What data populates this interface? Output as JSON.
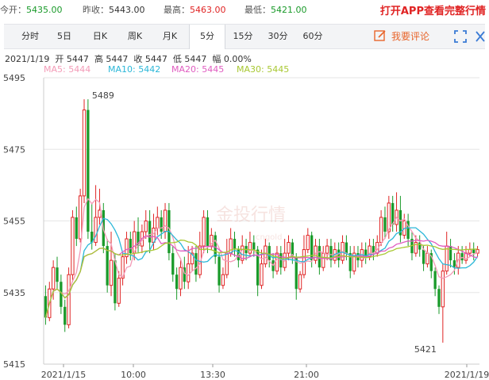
{
  "quote": {
    "open_label": "今开：",
    "open_value": "5435.00",
    "prev_label": "昨收：",
    "prev_value": "5443.00",
    "high_label": "最高：",
    "high_value": "5463.00",
    "low_label": "最低：",
    "low_value": "5421.00"
  },
  "app_link": "打开APP查看完整行情",
  "tabs": [
    {
      "label": "分时"
    },
    {
      "label": "5日"
    },
    {
      "label": "日K"
    },
    {
      "label": "周K"
    },
    {
      "label": "月K"
    },
    {
      "label": "5分"
    },
    {
      "label": "15分"
    },
    {
      "label": "30分"
    },
    {
      "label": "60分"
    }
  ],
  "active_tab": "5分",
  "comment_label": "我要评论",
  "info": {
    "date": "2021/1/19",
    "open_label": "开",
    "open": "5447",
    "high_label": "高",
    "high": "5447",
    "close_label": "收",
    "close": "5447",
    "low_label": "低",
    "low": "5447",
    "change_label": "幅",
    "change": "0.00%"
  },
  "ma": [
    {
      "label": "MA5: 5444",
      "color": "#f39bb7"
    },
    {
      "label": "MA10: 5442",
      "color": "#2bb7d8"
    },
    {
      "label": "MA20: 5445",
      "color": "#e05cc0"
    },
    {
      "label": "MA30: 5445",
      "color": "#a8c832"
    }
  ],
  "colors": {
    "up": "#e02424",
    "down": "#1a9a2a",
    "grid": "#e6e6e6"
  },
  "watermark": {
    "text": "金投行情",
    "sub": "cngold"
  },
  "chart_data": {
    "type": "candlestick",
    "ylim": [
      5415,
      5495
    ],
    "yticks": [
      5495,
      5475,
      5455,
      5435,
      5415
    ],
    "x_labels": [
      "2021/1/15",
      "10:00",
      "13:30",
      "21:00",
      "2021/1/19"
    ],
    "annotations": [
      {
        "text": "5489",
        "value": 5489
      },
      {
        "text": "5421",
        "value": 5421
      }
    ],
    "candles": [
      [
        5434,
        5428,
        5437,
        5426
      ],
      [
        5428,
        5436,
        5438,
        5427
      ],
      [
        5436,
        5442,
        5444,
        5433
      ],
      [
        5442,
        5438,
        5445,
        5436
      ],
      [
        5438,
        5431,
        5440,
        5429
      ],
      [
        5431,
        5426,
        5433,
        5424
      ],
      [
        5426,
        5440,
        5442,
        5425
      ],
      [
        5440,
        5456,
        5458,
        5438
      ],
      [
        5456,
        5450,
        5459,
        5448
      ],
      [
        5450,
        5462,
        5464,
        5449
      ],
      [
        5462,
        5486,
        5489,
        5460
      ],
      [
        5486,
        5452,
        5489,
        5450
      ],
      [
        5452,
        5449,
        5460,
        5447
      ],
      [
        5449,
        5456,
        5465,
        5448
      ],
      [
        5456,
        5458,
        5464,
        5454
      ],
      [
        5458,
        5448,
        5460,
        5446
      ],
      [
        5448,
        5437,
        5450,
        5435
      ],
      [
        5437,
        5444,
        5452,
        5434
      ],
      [
        5444,
        5432,
        5446,
        5430
      ],
      [
        5432,
        5439,
        5441,
        5431
      ],
      [
        5439,
        5445,
        5446,
        5437
      ],
      [
        5445,
        5450,
        5452,
        5443
      ],
      [
        5450,
        5446,
        5452,
        5444
      ],
      [
        5446,
        5452,
        5455,
        5444
      ],
      [
        5452,
        5448,
        5456,
        5446
      ],
      [
        5448,
        5452,
        5454,
        5446
      ],
      [
        5452,
        5455,
        5458,
        5450
      ],
      [
        5455,
        5449,
        5458,
        5446
      ],
      [
        5449,
        5453,
        5457,
        5447
      ],
      [
        5453,
        5456,
        5459,
        5451
      ],
      [
        5456,
        5452,
        5458,
        5450
      ],
      [
        5452,
        5458,
        5460,
        5450
      ],
      [
        5458,
        5446,
        5460,
        5444
      ],
      [
        5446,
        5440,
        5448,
        5438
      ],
      [
        5440,
        5436,
        5442,
        5433
      ],
      [
        5436,
        5442,
        5444,
        5434
      ],
      [
        5442,
        5438,
        5445,
        5436
      ],
      [
        5438,
        5443,
        5448,
        5436
      ],
      [
        5443,
        5446,
        5448,
        5441
      ],
      [
        5446,
        5440,
        5448,
        5438
      ],
      [
        5440,
        5448,
        5452,
        5439
      ],
      [
        5448,
        5456,
        5458,
        5446
      ],
      [
        5456,
        5448,
        5458,
        5446
      ],
      [
        5448,
        5451,
        5453,
        5447
      ],
      [
        5451,
        5445,
        5452,
        5443
      ],
      [
        5445,
        5437,
        5446,
        5435
      ],
      [
        5437,
        5440,
        5442,
        5436
      ],
      [
        5440,
        5446,
        5450,
        5439
      ],
      [
        5446,
        5450,
        5453,
        5445
      ],
      [
        5450,
        5447,
        5452,
        5445
      ],
      [
        5447,
        5444,
        5448,
        5442
      ],
      [
        5444,
        5448,
        5451,
        5443
      ],
      [
        5448,
        5446,
        5450,
        5444
      ],
      [
        5446,
        5449,
        5452,
        5445
      ],
      [
        5449,
        5447,
        5451,
        5445
      ],
      [
        5447,
        5437,
        5448,
        5434
      ],
      [
        5437,
        5443,
        5447,
        5436
      ],
      [
        5443,
        5448,
        5450,
        5442
      ],
      [
        5448,
        5444,
        5449,
        5442
      ],
      [
        5444,
        5441,
        5446,
        5439
      ],
      [
        5441,
        5446,
        5448,
        5440
      ],
      [
        5446,
        5442,
        5448,
        5440
      ],
      [
        5442,
        5446,
        5450,
        5441
      ],
      [
        5446,
        5449,
        5451,
        5444
      ],
      [
        5449,
        5445,
        5450,
        5443
      ],
      [
        5445,
        5436,
        5446,
        5433
      ],
      [
        5436,
        5440,
        5441,
        5435
      ],
      [
        5440,
        5447,
        5451,
        5439
      ],
      [
        5447,
        5451,
        5453,
        5446
      ],
      [
        5451,
        5444,
        5452,
        5442
      ],
      [
        5444,
        5448,
        5450,
        5443
      ],
      [
        5448,
        5442,
        5450,
        5440
      ],
      [
        5442,
        5446,
        5448,
        5441
      ],
      [
        5446,
        5448,
        5450,
        5444
      ],
      [
        5448,
        5444,
        5450,
        5442
      ],
      [
        5444,
        5447,
        5449,
        5443
      ],
      [
        5447,
        5444,
        5449,
        5442
      ],
      [
        5444,
        5449,
        5451,
        5443
      ],
      [
        5449,
        5446,
        5451,
        5444
      ],
      [
        5446,
        5441,
        5448,
        5439
      ],
      [
        5441,
        5446,
        5448,
        5440
      ],
      [
        5446,
        5444,
        5448,
        5442
      ],
      [
        5444,
        5447,
        5449,
        5442
      ],
      [
        5447,
        5445,
        5449,
        5443
      ],
      [
        5445,
        5448,
        5450,
        5444
      ],
      [
        5448,
        5446,
        5450,
        5444
      ],
      [
        5446,
        5449,
        5451,
        5445
      ],
      [
        5449,
        5456,
        5458,
        5448
      ],
      [
        5456,
        5452,
        5459,
        5450
      ],
      [
        5452,
        5460,
        5462,
        5450
      ],
      [
        5460,
        5454,
        5462,
        5452
      ],
      [
        5454,
        5458,
        5463,
        5452
      ],
      [
        5458,
        5451,
        5462,
        5449
      ],
      [
        5451,
        5455,
        5457,
        5450
      ],
      [
        5455,
        5450,
        5457,
        5448
      ],
      [
        5450,
        5446,
        5452,
        5444
      ],
      [
        5446,
        5449,
        5451,
        5445
      ],
      [
        5449,
        5447,
        5451,
        5445
      ],
      [
        5447,
        5443,
        5448,
        5441
      ],
      [
        5443,
        5446,
        5448,
        5442
      ],
      [
        5446,
        5441,
        5447,
        5439
      ],
      [
        5441,
        5436,
        5442,
        5434
      ],
      [
        5436,
        5431,
        5437,
        5429
      ],
      [
        5431,
        5441,
        5443,
        5421
      ],
      [
        5441,
        5448,
        5452,
        5440
      ],
      [
        5448,
        5444,
        5450,
        5442
      ],
      [
        5444,
        5442,
        5446,
        5440
      ],
      [
        5442,
        5446,
        5448,
        5440
      ],
      [
        5446,
        5444,
        5448,
        5443
      ],
      [
        5444,
        5446,
        5448,
        5443
      ],
      [
        5446,
        5447,
        5449,
        5445
      ],
      [
        5447,
        5446,
        5449,
        5444
      ],
      [
        5446,
        5447,
        5448,
        5445
      ]
    ]
  }
}
